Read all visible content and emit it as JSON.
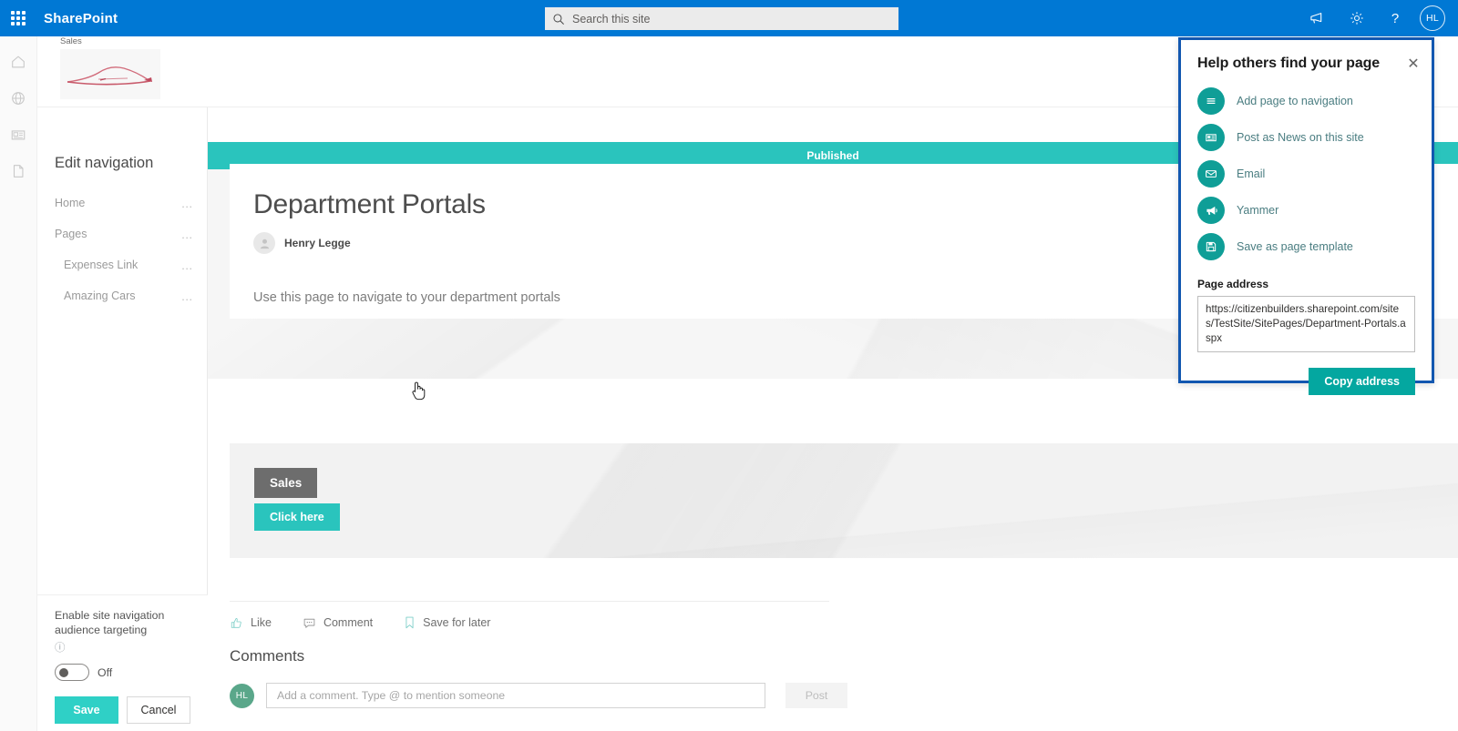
{
  "suitebar": {
    "waffle_name": "app-launcher",
    "brand": "SharePoint",
    "search_placeholder": "Search this site",
    "search_value": "",
    "icons": [
      {
        "name": "announcements-icon",
        "glyph": "megaphone"
      },
      {
        "name": "settings-gear-icon",
        "glyph": "gear"
      },
      {
        "name": "help-icon",
        "glyph": "?"
      }
    ],
    "avatar_initials": "HL"
  },
  "rail": {
    "items": [
      {
        "name": "sidebar-item-home",
        "icon": "home-icon"
      },
      {
        "name": "sidebar-item-sites",
        "icon": "globe-icon"
      },
      {
        "name": "sidebar-item-news",
        "icon": "news-icon"
      },
      {
        "name": "sidebar-item-pages",
        "icon": "page-icon"
      }
    ]
  },
  "thumbnail_card": {
    "title": "Sales",
    "image_alt": "car-line-art"
  },
  "nav_panel": {
    "title": "Edit navigation",
    "items": [
      {
        "label": "Home",
        "indent": false,
        "menu": "…"
      },
      {
        "label": "Pages",
        "indent": false,
        "menu": "…"
      },
      {
        "label": "Expenses Link",
        "indent": true,
        "menu": "…"
      },
      {
        "label": "Amazing Cars",
        "indent": true,
        "menu": "…"
      }
    ],
    "audience_label": "Enable site navigation audience targeting",
    "audience_info_glyph": "ⓘ",
    "toggle_state": "Off",
    "save_label": "Save",
    "cancel_label": "Cancel"
  },
  "page": {
    "status_banner": "Published",
    "title": "Department Portals",
    "author": "Henry Legge",
    "body_text": "Use this page to navigate to your department portals"
  },
  "banner_webpart": {
    "tag": "Sales",
    "cta_label": "Click here"
  },
  "social": {
    "items": [
      {
        "label": "Like",
        "icon": "thumbs-up-icon"
      },
      {
        "label": "Comment",
        "icon": "comment-bubble-icon"
      },
      {
        "label": "Save for later",
        "icon": "bookmark-icon"
      }
    ]
  },
  "comments": {
    "heading": "Comments",
    "avatar_initials": "HL",
    "input_placeholder": "Add a comment. Type @ to mention someone",
    "input_value": "",
    "post_label": "Post"
  },
  "help_panel": {
    "title": "Help others find your page",
    "close_glyph": "✕",
    "options": [
      {
        "label": "Add page to navigation",
        "icon": "navigation-lines-icon"
      },
      {
        "label": "Post as News on this site",
        "icon": "news-card-icon"
      },
      {
        "label": "Email",
        "icon": "envelope-icon"
      },
      {
        "label": "Yammer",
        "icon": "yammer-megaphone-icon"
      },
      {
        "label": "Save as page template",
        "icon": "save-floppy-icon"
      }
    ],
    "address_label": "Page address",
    "address_value": "https://citizenbuilders.sharepoint.com/sites/TestSite/SitePages/Department-Portals.aspx",
    "copy_label": "Copy address"
  },
  "colors": {
    "suitebar_blue": "#0078d4",
    "teal_accent": "#2ac4bd",
    "teal_icon": "#0f9e97",
    "copy_button": "#04a7a0",
    "panel_border_blue": "#1257b0",
    "save_button": "#2fd0c6",
    "tag_gray": "#6d6d6d"
  }
}
